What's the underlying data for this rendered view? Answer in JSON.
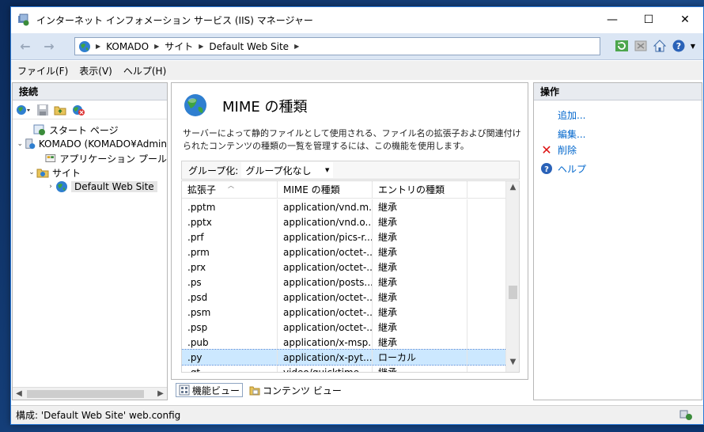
{
  "window": {
    "title": "インターネット インフォメーション サービス (IIS) マネージャー",
    "controls": {
      "minimize": "—",
      "maximize": "☐",
      "close": "✕"
    }
  },
  "address": {
    "crumbs": [
      "KOMADO",
      "サイト",
      "Default Web Site"
    ]
  },
  "menu": [
    "ファイル(F)",
    "表示(V)",
    "ヘルプ(H)"
  ],
  "connections": {
    "header": "接続",
    "tree": [
      {
        "label": "スタート ページ"
      },
      {
        "label": "KOMADO (KOMADO¥Admin"
      },
      {
        "label": "アプリケーション プール"
      },
      {
        "label": "サイト"
      },
      {
        "label": "Default Web Site"
      }
    ]
  },
  "feature": {
    "title": "MIME の種類",
    "description": "サーバーによって静的ファイルとして使用される、ファイル名の拡張子および関連付けられたコンテンツの種類の一覧を管理するには、この機能を使用します。",
    "group_label": "グループ化:",
    "group_value": "グループ化なし",
    "columns": [
      "拡張子",
      "MIME の種類",
      "エントリの種類"
    ],
    "rows": [
      [
        ".pptm",
        "application/vnd.m...",
        "継承"
      ],
      [
        ".pptx",
        "application/vnd.o...",
        "継承"
      ],
      [
        ".prf",
        "application/pics-r...",
        "継承"
      ],
      [
        ".prm",
        "application/octet-...",
        "継承"
      ],
      [
        ".prx",
        "application/octet-...",
        "継承"
      ],
      [
        ".ps",
        "application/posts...",
        "継承"
      ],
      [
        ".psd",
        "application/octet-...",
        "継承"
      ],
      [
        ".psm",
        "application/octet-...",
        "継承"
      ],
      [
        ".psp",
        "application/octet-...",
        "継承"
      ],
      [
        ".pub",
        "application/x-msp...",
        "継承"
      ],
      [
        ".py",
        "application/x-pyt...",
        "ローカル"
      ],
      [
        ".qt",
        "video/quicktime",
        "継承"
      ]
    ],
    "selected_row": 10
  },
  "views": {
    "features": "機能ビュー",
    "content": "コンテンツ ビュー"
  },
  "actions": {
    "header": "操作",
    "items": [
      "追加...",
      "編集...",
      "削除",
      "ヘルプ"
    ]
  },
  "status": "構成: 'Default Web Site' web.config",
  "colors": {
    "link": "#0066cc",
    "selected": "#cce8ff",
    "header_bg": "#e8ebf0"
  }
}
